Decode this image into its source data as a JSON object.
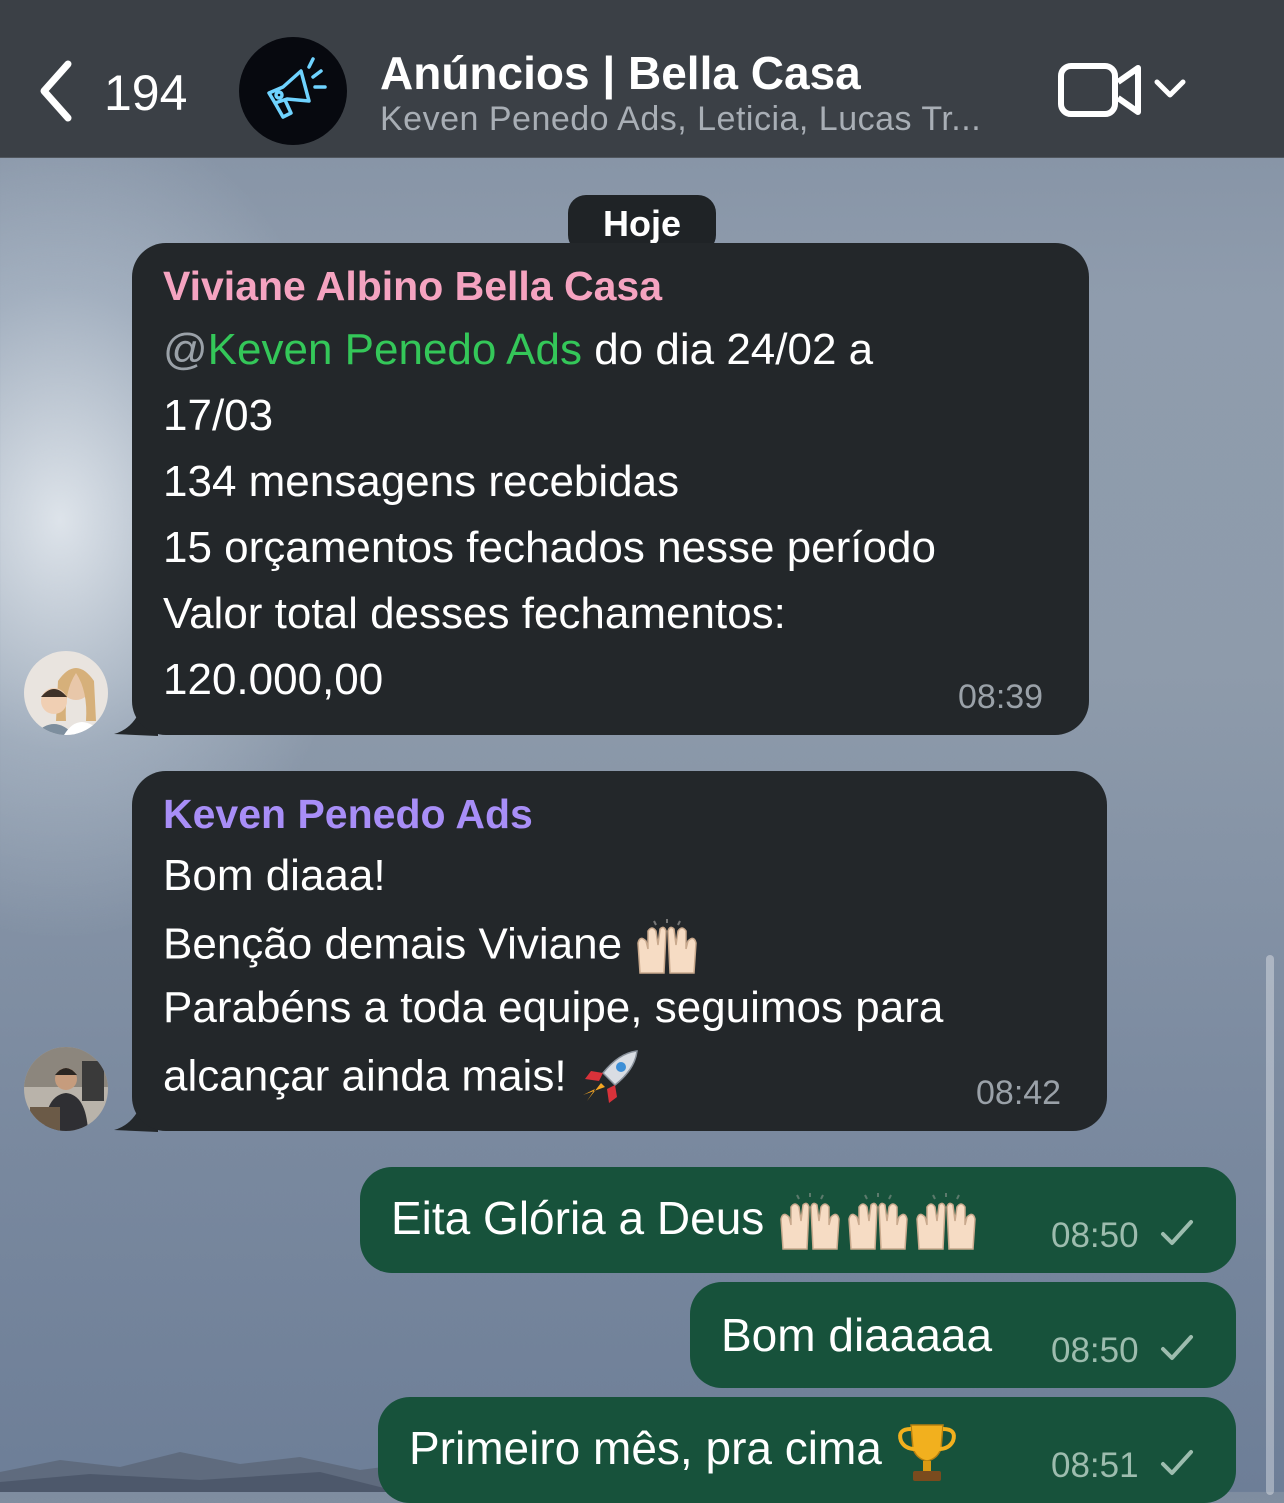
{
  "header": {
    "back_count": "194",
    "title": "Anúncios | Bella Casa",
    "subtitle": "Keven Penedo Ads, Leticia, Lucas Tr..."
  },
  "date_separator": "Hoje",
  "messages": [
    {
      "sender": "Viviane Albino Bella Casa",
      "sender_color": "#f5a3c0",
      "mention_at": "@",
      "mention_name": "Keven Penedo Ads",
      "line1_rest": " do dia 24/02 a",
      "line2": "17/03",
      "line3": "134 mensagens recebidas",
      "line4": "15 orçamentos fechados nesse período",
      "line5": "Valor total desses fechamentos:",
      "line6": "120.000,00",
      "time": "08:39"
    },
    {
      "sender": "Keven Penedo Ads",
      "sender_color": "#a88ef7",
      "line1": "Bom diaaa!",
      "line2": "Benção demais Viviane",
      "line2_emoji": "raising-hands-emoji",
      "line3": "Parabéns a toda equipe, seguimos para",
      "line4": "alcançar ainda mais!",
      "line4_emoji": "rocket-emoji",
      "time": "08:42"
    }
  ],
  "outgoing": [
    {
      "text": "Eita Glória a Deus",
      "emoji": "raising-hands-emoji x3",
      "time": "08:50"
    },
    {
      "text": "Bom diaaaaa",
      "time": "08:50"
    },
    {
      "text": "Primeiro mês, pra cima",
      "emoji": "trophy-emoji",
      "time": "08:51"
    }
  ],
  "colors": {
    "header_bg": "#3b4046",
    "incoming_bubble": "#23272a",
    "outgoing_bubble": "#17523b",
    "mention": "#34c759"
  }
}
